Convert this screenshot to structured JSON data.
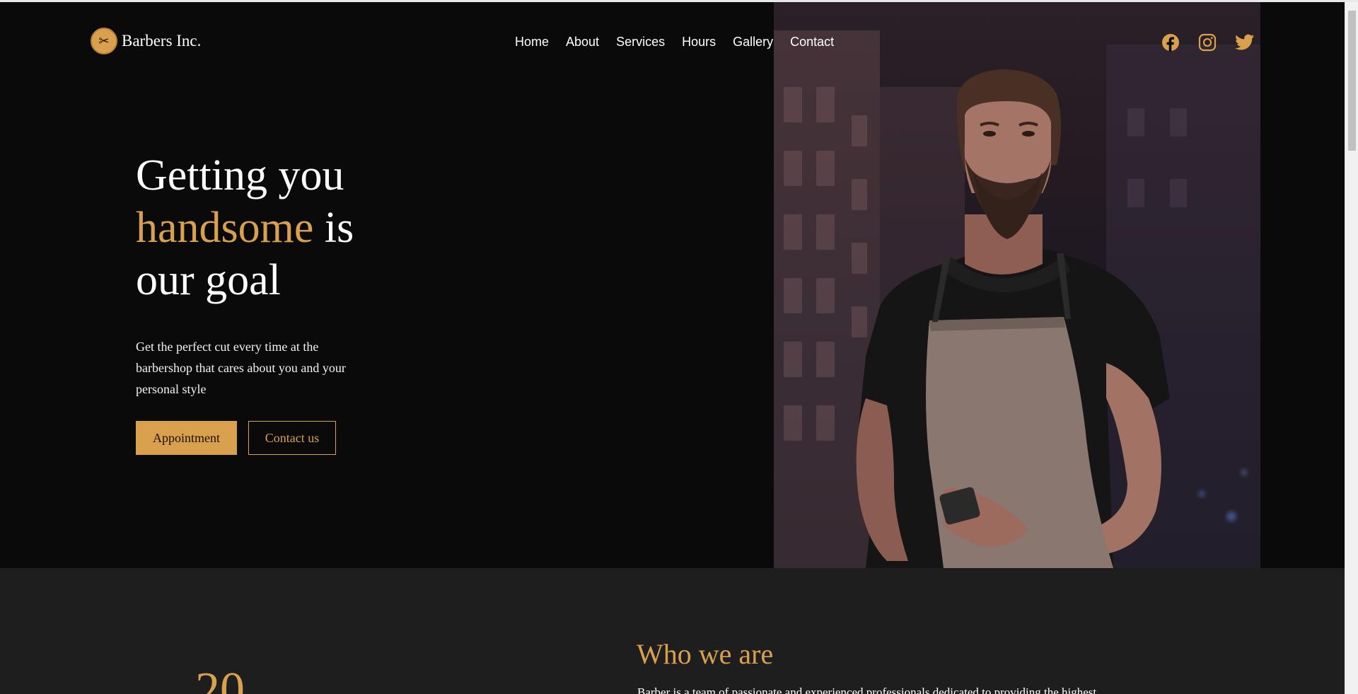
{
  "brand": {
    "name": "Barbers Inc.",
    "logo_icon": "scissors-icon",
    "accent": "#d9a04e"
  },
  "nav": {
    "links": [
      "Home",
      "About",
      "Services",
      "Hours",
      "Gallery",
      "Contact"
    ]
  },
  "social": [
    {
      "name": "facebook-icon"
    },
    {
      "name": "instagram-icon"
    },
    {
      "name": "twitter-icon"
    }
  ],
  "hero": {
    "headline_line1": "Getting you",
    "headline_gold": "handsome",
    "headline_line2_rest": " is",
    "headline_line3": "our goal",
    "subtext": "Get the perfect cut every time at the barbershop that cares about you and your personal style",
    "primary_button": "Appointment",
    "secondary_button": "Contact us"
  },
  "about": {
    "title": "Who we are",
    "text": "Barber is a team of passionate and experienced professionals dedicated to providing the highest",
    "big_number": "20"
  },
  "colors": {
    "background": "#0a0a0a",
    "section_bg": "#1e1e1e",
    "gold": "#d9a04e"
  }
}
